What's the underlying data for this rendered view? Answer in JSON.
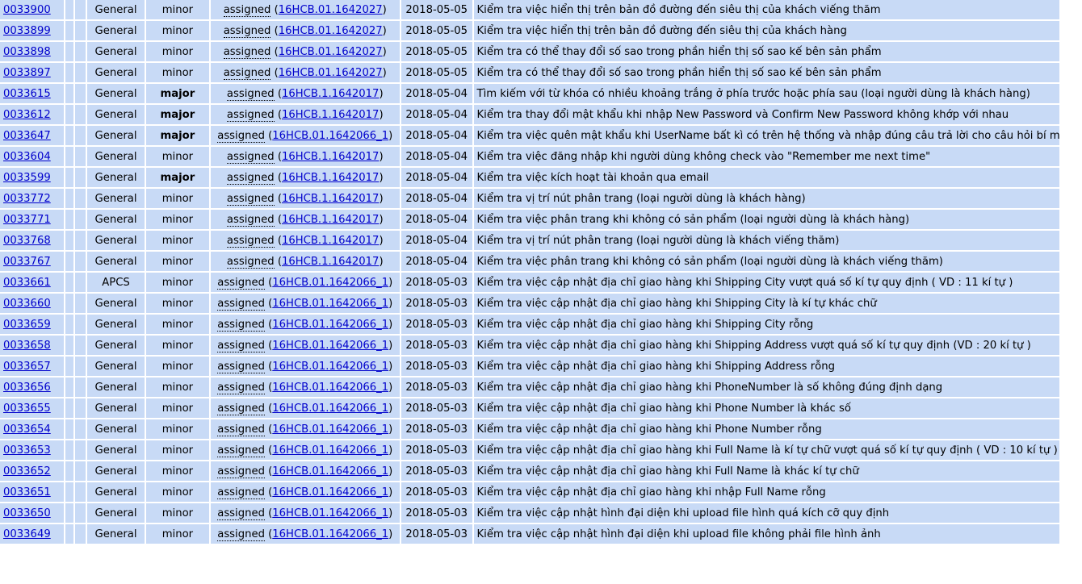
{
  "rows": [
    {
      "id": "0033900",
      "category": "General",
      "severity": "minor",
      "severity_major": false,
      "status": "assigned",
      "handler": "16HCB.01.1642027",
      "date": "2018-05-05",
      "summary": "Kiểm tra việc hiển thị trên bản đồ đường đến siêu thị của khách viếng thăm"
    },
    {
      "id": "0033899",
      "category": "General",
      "severity": "minor",
      "severity_major": false,
      "status": "assigned",
      "handler": "16HCB.01.1642027",
      "date": "2018-05-05",
      "summary": "Kiểm tra việc hiển thị trên bản đồ đường đến siêu thị của khách hàng"
    },
    {
      "id": "0033898",
      "category": "General",
      "severity": "minor",
      "severity_major": false,
      "status": "assigned",
      "handler": "16HCB.01.1642027",
      "date": "2018-05-05",
      "summary": "Kiểm tra có thể thay đổi số sao trong phần hiển thị số sao kế bên sản phẩm"
    },
    {
      "id": "0033897",
      "category": "General",
      "severity": "minor",
      "severity_major": false,
      "status": "assigned",
      "handler": "16HCB.01.1642027",
      "date": "2018-05-05",
      "summary": "Kiểm tra có thể thay đổi số sao trong phần hiển thị số sao kế bên sản phẩm"
    },
    {
      "id": "0033615",
      "category": "General",
      "severity": "major",
      "severity_major": true,
      "status": "assigned",
      "handler": "16HCB.1.1642017",
      "date": "2018-05-04",
      "summary": "Tìm kiếm với từ khóa có nhiều khoảng trắng ở phía trước hoặc phía sau (loại người dùng là khách hàng)"
    },
    {
      "id": "0033612",
      "category": "General",
      "severity": "major",
      "severity_major": true,
      "status": "assigned",
      "handler": "16HCB.1.1642017",
      "date": "2018-05-04",
      "summary": "Kiểm tra thay đổi mật khẩu khi nhập New Password và Confirm New Password không khớp với nhau"
    },
    {
      "id": "0033647",
      "category": "General",
      "severity": "major",
      "severity_major": true,
      "status": "assigned",
      "handler": "16HCB.01.1642066_1",
      "date": "2018-05-04",
      "summary": "Kiểm tra việc quên mật khẩu khi UserName bất kì có trên hệ thống và nhập đúng câu trả lời cho câu hỏi bí mật"
    },
    {
      "id": "0033604",
      "category": "General",
      "severity": "minor",
      "severity_major": false,
      "status": "assigned",
      "handler": "16HCB.1.1642017",
      "date": "2018-05-04",
      "summary": "Kiểm tra việc đăng nhập khi người dùng không check vào \"Remember me next time\""
    },
    {
      "id": "0033599",
      "category": "General",
      "severity": "major",
      "severity_major": true,
      "status": "assigned",
      "handler": "16HCB.1.1642017",
      "date": "2018-05-04",
      "summary": "Kiểm tra việc kích hoạt tài khoản qua email"
    },
    {
      "id": "0033772",
      "category": "General",
      "severity": "minor",
      "severity_major": false,
      "status": "assigned",
      "handler": "16HCB.1.1642017",
      "date": "2018-05-04",
      "summary": "Kiểm tra vị trí nút phân trang (loại người dùng là khách hàng)"
    },
    {
      "id": "0033771",
      "category": "General",
      "severity": "minor",
      "severity_major": false,
      "status": "assigned",
      "handler": "16HCB.1.1642017",
      "date": "2018-05-04",
      "summary": "Kiểm tra việc phân trang khi không có sản phẩm (loại người dùng là khách hàng)"
    },
    {
      "id": "0033768",
      "category": "General",
      "severity": "minor",
      "severity_major": false,
      "status": "assigned",
      "handler": "16HCB.1.1642017",
      "date": "2018-05-04",
      "summary": "Kiểm tra vị trí nút phân trang (loại người dùng là khách viếng thăm)"
    },
    {
      "id": "0033767",
      "category": "General",
      "severity": "minor",
      "severity_major": false,
      "status": "assigned",
      "handler": "16HCB.1.1642017",
      "date": "2018-05-04",
      "summary": "Kiểm tra việc phân trang khi không có sản phẩm (loại người dùng là khách viếng thăm)"
    },
    {
      "id": "0033661",
      "category": "APCS",
      "severity": "minor",
      "severity_major": false,
      "status": "assigned",
      "handler": "16HCB.01.1642066_1",
      "date": "2018-05-03",
      "summary": "Kiểm tra việc cập nhật địa chỉ giao hàng khi Shipping City vượt quá số kí tự quy định ( VD : 11 kí tự )"
    },
    {
      "id": "0033660",
      "category": "General",
      "severity": "minor",
      "severity_major": false,
      "status": "assigned",
      "handler": "16HCB.01.1642066_1",
      "date": "2018-05-03",
      "summary": "Kiểm tra việc cập nhật địa chỉ giao hàng khi Shipping City là kí tự khác chữ"
    },
    {
      "id": "0033659",
      "category": "General",
      "severity": "minor",
      "severity_major": false,
      "status": "assigned",
      "handler": "16HCB.01.1642066_1",
      "date": "2018-05-03",
      "summary": "Kiểm tra việc cập nhật địa chỉ giao hàng khi Shipping City rỗng"
    },
    {
      "id": "0033658",
      "category": "General",
      "severity": "minor",
      "severity_major": false,
      "status": "assigned",
      "handler": "16HCB.01.1642066_1",
      "date": "2018-05-03",
      "summary": "Kiểm tra việc cập nhật địa chỉ giao hàng khi Shipping Address vượt quá số kí tự quy định (VD : 20 kí tự )"
    },
    {
      "id": "0033657",
      "category": "General",
      "severity": "minor",
      "severity_major": false,
      "status": "assigned",
      "handler": "16HCB.01.1642066_1",
      "date": "2018-05-03",
      "summary": "Kiểm tra việc cập nhật địa chỉ giao hàng khi Shipping Address rỗng"
    },
    {
      "id": "0033656",
      "category": "General",
      "severity": "minor",
      "severity_major": false,
      "status": "assigned",
      "handler": "16HCB.01.1642066_1",
      "date": "2018-05-03",
      "summary": "Kiểm tra việc cập nhật địa chỉ giao hàng khi PhoneNumber là số không đúng định dạng"
    },
    {
      "id": "0033655",
      "category": "General",
      "severity": "minor",
      "severity_major": false,
      "status": "assigned",
      "handler": "16HCB.01.1642066_1",
      "date": "2018-05-03",
      "summary": "Kiểm tra việc cập nhật địa chỉ giao hàng khi Phone Number là khác số"
    },
    {
      "id": "0033654",
      "category": "General",
      "severity": "minor",
      "severity_major": false,
      "status": "assigned",
      "handler": "16HCB.01.1642066_1",
      "date": "2018-05-03",
      "summary": "Kiểm tra việc cập nhật địa chỉ giao hàng khi Phone Number rỗng"
    },
    {
      "id": "0033653",
      "category": "General",
      "severity": "minor",
      "severity_major": false,
      "status": "assigned",
      "handler": "16HCB.01.1642066_1",
      "date": "2018-05-03",
      "summary": "Kiểm tra việc cập nhật địa chỉ giao hàng khi Full Name là kí tự chữ vượt quá số kí tự quy định ( VD : 10 kí tự )"
    },
    {
      "id": "0033652",
      "category": "General",
      "severity": "minor",
      "severity_major": false,
      "status": "assigned",
      "handler": "16HCB.01.1642066_1",
      "date": "2018-05-03",
      "summary": "Kiểm tra việc cập nhật địa chỉ giao hàng khi Full Name là khác kí tự chữ"
    },
    {
      "id": "0033651",
      "category": "General",
      "severity": "minor",
      "severity_major": false,
      "status": "assigned",
      "handler": "16HCB.01.1642066_1",
      "date": "2018-05-03",
      "summary": "Kiểm tra việc cập nhật địa chỉ giao hàng khi nhập Full Name rỗng"
    },
    {
      "id": "0033650",
      "category": "General",
      "severity": "minor",
      "severity_major": false,
      "status": "assigned",
      "handler": "16HCB.01.1642066_1",
      "date": "2018-05-03",
      "summary": "Kiểm tra việc cập nhật hình đại diện khi upload file hình quá kích cỡ quy định"
    },
    {
      "id": "0033649",
      "category": "General",
      "severity": "minor",
      "severity_major": false,
      "status": "assigned",
      "handler": "16HCB.01.1642066_1",
      "date": "2018-05-03",
      "summary": "Kiểm tra việc cập nhật hình đại diện khi upload file không phải file hình ảnh"
    }
  ],
  "colors": {
    "row_bg": "#c8daf6",
    "link": "#0000cc",
    "border": "#ffffff"
  }
}
